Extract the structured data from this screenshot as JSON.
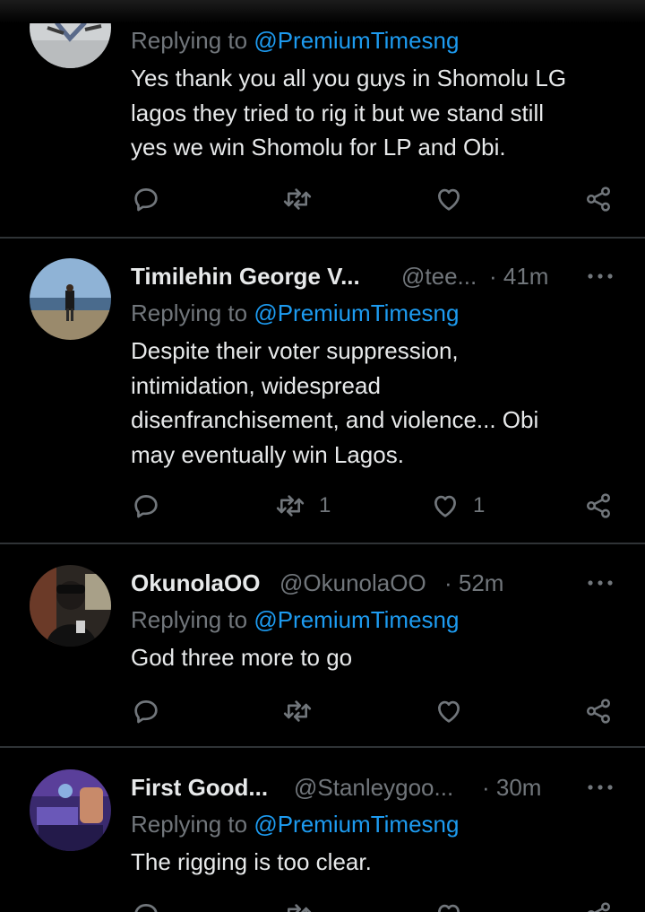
{
  "colors": {
    "background": "#000000",
    "text": "#e7e9ea",
    "secondary": "#71767b",
    "accent": "#1d9bf0",
    "divider": "#2f3336"
  },
  "tweets": [
    {
      "name": "",
      "handle": "",
      "time": "",
      "replying_prefix": "Replying to ",
      "replying_to": "@PremiumTimesng",
      "text_lines": [
        "Yes thank you all  you guys in Shomolu  LG",
        "lagos they tried to rig it but we stand still",
        "yes we win Shomolu for LP and Obi."
      ],
      "reply_count": "",
      "retweet_count": "",
      "like_count": "",
      "icons": [
        "reply-icon",
        "retweet-icon",
        "like-icon",
        "share-icon"
      ]
    },
    {
      "name": "Timilehin George V...",
      "handle": "@tee...",
      "time": "· 41m",
      "replying_prefix": "Replying to ",
      "replying_to": "@PremiumTimesng",
      "text_lines": [
        "Despite their voter suppression,",
        "intimidation, widespread",
        "disenfranchisement, and violence... Obi",
        "may eventually win Lagos."
      ],
      "reply_count": "",
      "retweet_count": "1",
      "like_count": "1",
      "icons": [
        "reply-icon",
        "retweet-icon",
        "like-icon",
        "share-icon"
      ]
    },
    {
      "name": "OkunolaOO",
      "handle": "@OkunolaOO",
      "time": "· 52m",
      "replying_prefix": "Replying to ",
      "replying_to": "@PremiumTimesng",
      "text_lines": [
        "God three more to go"
      ],
      "reply_count": "",
      "retweet_count": "",
      "like_count": "",
      "icons": [
        "reply-icon",
        "retweet-icon",
        "like-icon",
        "share-icon"
      ]
    },
    {
      "name": "First Good...",
      "handle": "@Stanleygoo...",
      "time": "· 30m",
      "replying_prefix": "Replying to ",
      "replying_to": "@PremiumTimesng",
      "text_lines": [
        "The rigging is too clear."
      ],
      "reply_count": "",
      "retweet_count": "",
      "like_count": "",
      "icons": [
        "reply-icon",
        "retweet-icon",
        "like-icon",
        "share-icon"
      ]
    }
  ]
}
